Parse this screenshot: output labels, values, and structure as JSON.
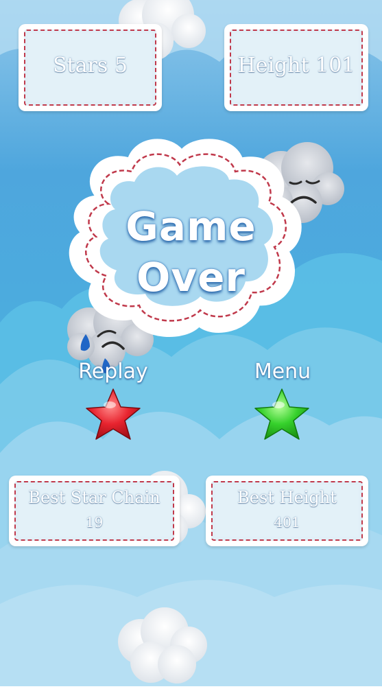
{
  "hud": {
    "stars_label": "Stars 5",
    "height_label": "Height 101"
  },
  "title": {
    "line1": "Game",
    "line2": "Over"
  },
  "buttons": {
    "replay_label": "Replay",
    "menu_label": "Menu"
  },
  "records": {
    "best_chain_label": "Best Star Chain",
    "best_chain_value": "19",
    "best_height_label": "Best Height",
    "best_height_value": "401"
  },
  "colors": {
    "sky_top": "#5aaee0",
    "sky_light": "#a9d7f0",
    "replay_star": "#e8242f",
    "menu_star": "#36d12c",
    "dash": "#c0394b"
  },
  "icons": {
    "replay": "red-star-icon",
    "menu": "green-star-icon",
    "sad_cloud": "sad-cloud-icon"
  }
}
